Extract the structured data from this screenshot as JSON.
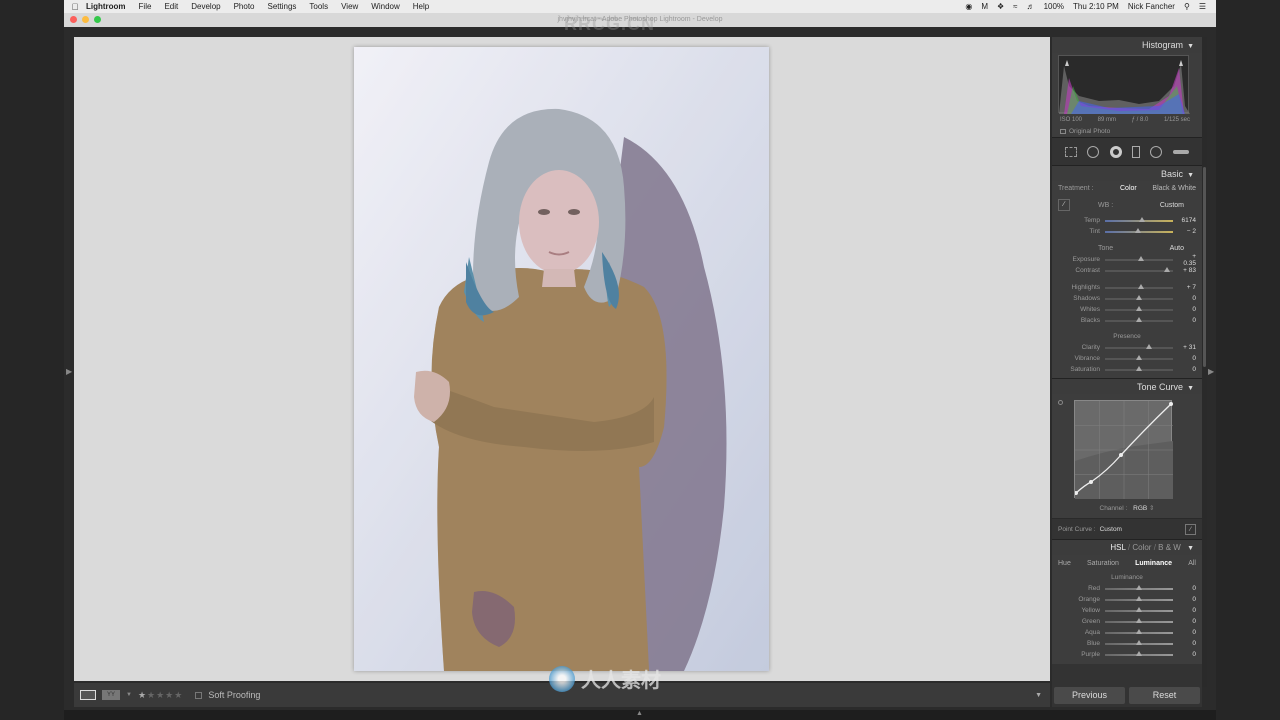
{
  "menubar": {
    "app": "Lightroom",
    "items": [
      "File",
      "Edit",
      "Develop",
      "Photo",
      "Settings",
      "Tools",
      "View",
      "Window",
      "Help"
    ],
    "battery": "100%",
    "clock": "Thu 2:10 PM",
    "user": "Nick Fancher"
  },
  "window": {
    "title": "jhvjhvjh.lrcat - Adobe Photoshop Lightroom - Develop"
  },
  "histogram": {
    "title": "Histogram",
    "iso": "ISO 100",
    "focal": "89 mm",
    "aperture": "ƒ / 8.0",
    "shutter": "1/125 sec",
    "original_photo": "Original Photo"
  },
  "basic": {
    "title": "Basic",
    "treatment_label": "Treatment :",
    "treatment_color": "Color",
    "treatment_bw": "Black & White",
    "wb_label": "WB :",
    "wb_value": "Custom",
    "tone_label": "Tone",
    "auto_label": "Auto",
    "presence_label": "Presence",
    "sliders_wb": [
      {
        "label": "Temp",
        "value": "6174",
        "pos": 0.55
      },
      {
        "label": "Tint",
        "value": "− 2",
        "pos": 0.48
      }
    ],
    "sliders_tone": [
      {
        "label": "Exposure",
        "value": "+ 0.35",
        "pos": 0.53
      },
      {
        "label": "Contrast",
        "value": "+ 83",
        "pos": 0.91
      }
    ],
    "sliders_tone2": [
      {
        "label": "Highlights",
        "value": "+ 7",
        "pos": 0.53
      },
      {
        "label": "Shadows",
        "value": "0",
        "pos": 0.5
      },
      {
        "label": "Whites",
        "value": "0",
        "pos": 0.5
      },
      {
        "label": "Blacks",
        "value": "0",
        "pos": 0.5
      }
    ],
    "sliders_presence": [
      {
        "label": "Clarity",
        "value": "+ 31",
        "pos": 0.65
      },
      {
        "label": "Vibrance",
        "value": "0",
        "pos": 0.5
      },
      {
        "label": "Saturation",
        "value": "0",
        "pos": 0.5
      }
    ]
  },
  "tone_curve": {
    "title": "Tone Curve",
    "channel_label": "Channel :",
    "channel_value": "RGB",
    "point_curve_label": "Point Curve :",
    "point_curve_value": "Custom"
  },
  "hsl": {
    "title_hsl": "HSL",
    "title_color": "Color",
    "title_bw": "B & W",
    "tabs": [
      "Hue",
      "Saturation",
      "Luminance",
      "All"
    ],
    "active_tab": "Luminance",
    "section": "Luminance",
    "sliders": [
      {
        "label": "Red",
        "value": "0",
        "pos": 0.5
      },
      {
        "label": "Orange",
        "value": "0",
        "pos": 0.5
      },
      {
        "label": "Yellow",
        "value": "0",
        "pos": 0.5
      },
      {
        "label": "Green",
        "value": "0",
        "pos": 0.5
      },
      {
        "label": "Aqua",
        "value": "0",
        "pos": 0.5
      },
      {
        "label": "Blue",
        "value": "0",
        "pos": 0.5
      },
      {
        "label": "Purple",
        "value": "0",
        "pos": 0.5
      }
    ]
  },
  "footer": {
    "previous": "Previous",
    "reset": "Reset"
  },
  "toolbar": {
    "soft_proofing": "Soft Proofing"
  },
  "watermark": {
    "site": "RRCG.CN",
    "text": "RRCG",
    "chinese": "人人素材"
  },
  "colors": {
    "panel": "#333333",
    "workspace": "#dadada",
    "accent": "#dddddd"
  }
}
